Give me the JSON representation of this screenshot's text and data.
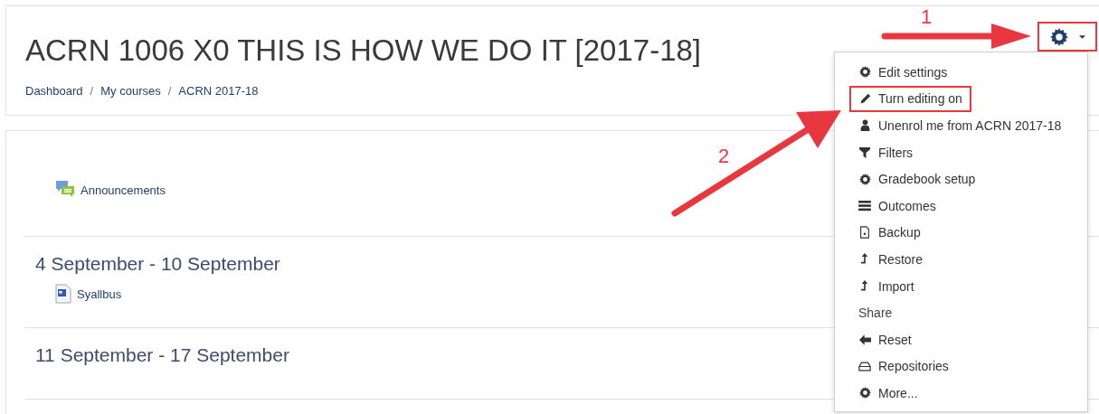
{
  "header": {
    "title": "ACRN 1006 X0 THIS IS HOW WE DO IT [2017-18]",
    "breadcrumb": [
      "Dashboard",
      "My courses",
      "ACRN 2017-18"
    ],
    "breadcrumb_separators": [
      "/",
      "/"
    ]
  },
  "settings_button": {
    "highlighted": true
  },
  "sections": [
    {
      "activities": [
        {
          "label": "Announcements",
          "kind": "forum"
        }
      ]
    },
    {
      "title": "4 September - 10 September",
      "activities": [
        {
          "label": "Syallbus",
          "kind": "document"
        }
      ]
    },
    {
      "title": "11 September - 17 September"
    }
  ],
  "menu": [
    {
      "label": "Edit settings",
      "kind": "link"
    },
    {
      "label": "Turn editing on",
      "kind": "link",
      "highlighted": true
    },
    {
      "label": "Unenrol me from ACRN 2017-18",
      "kind": "link"
    },
    {
      "label": "Filters",
      "kind": "link"
    },
    {
      "label": "Gradebook setup",
      "kind": "link"
    },
    {
      "label": "Outcomes",
      "kind": "link"
    },
    {
      "label": "Backup",
      "kind": "link"
    },
    {
      "label": "Restore",
      "kind": "link"
    },
    {
      "label": "Import",
      "kind": "link"
    },
    {
      "label": "Share",
      "kind": "heading"
    },
    {
      "label": "Reset",
      "kind": "link"
    },
    {
      "label": "Repositories",
      "kind": "link"
    },
    {
      "label": "More...",
      "kind": "link"
    }
  ],
  "callouts": [
    {
      "number": "1"
    },
    {
      "number": "2"
    }
  ]
}
